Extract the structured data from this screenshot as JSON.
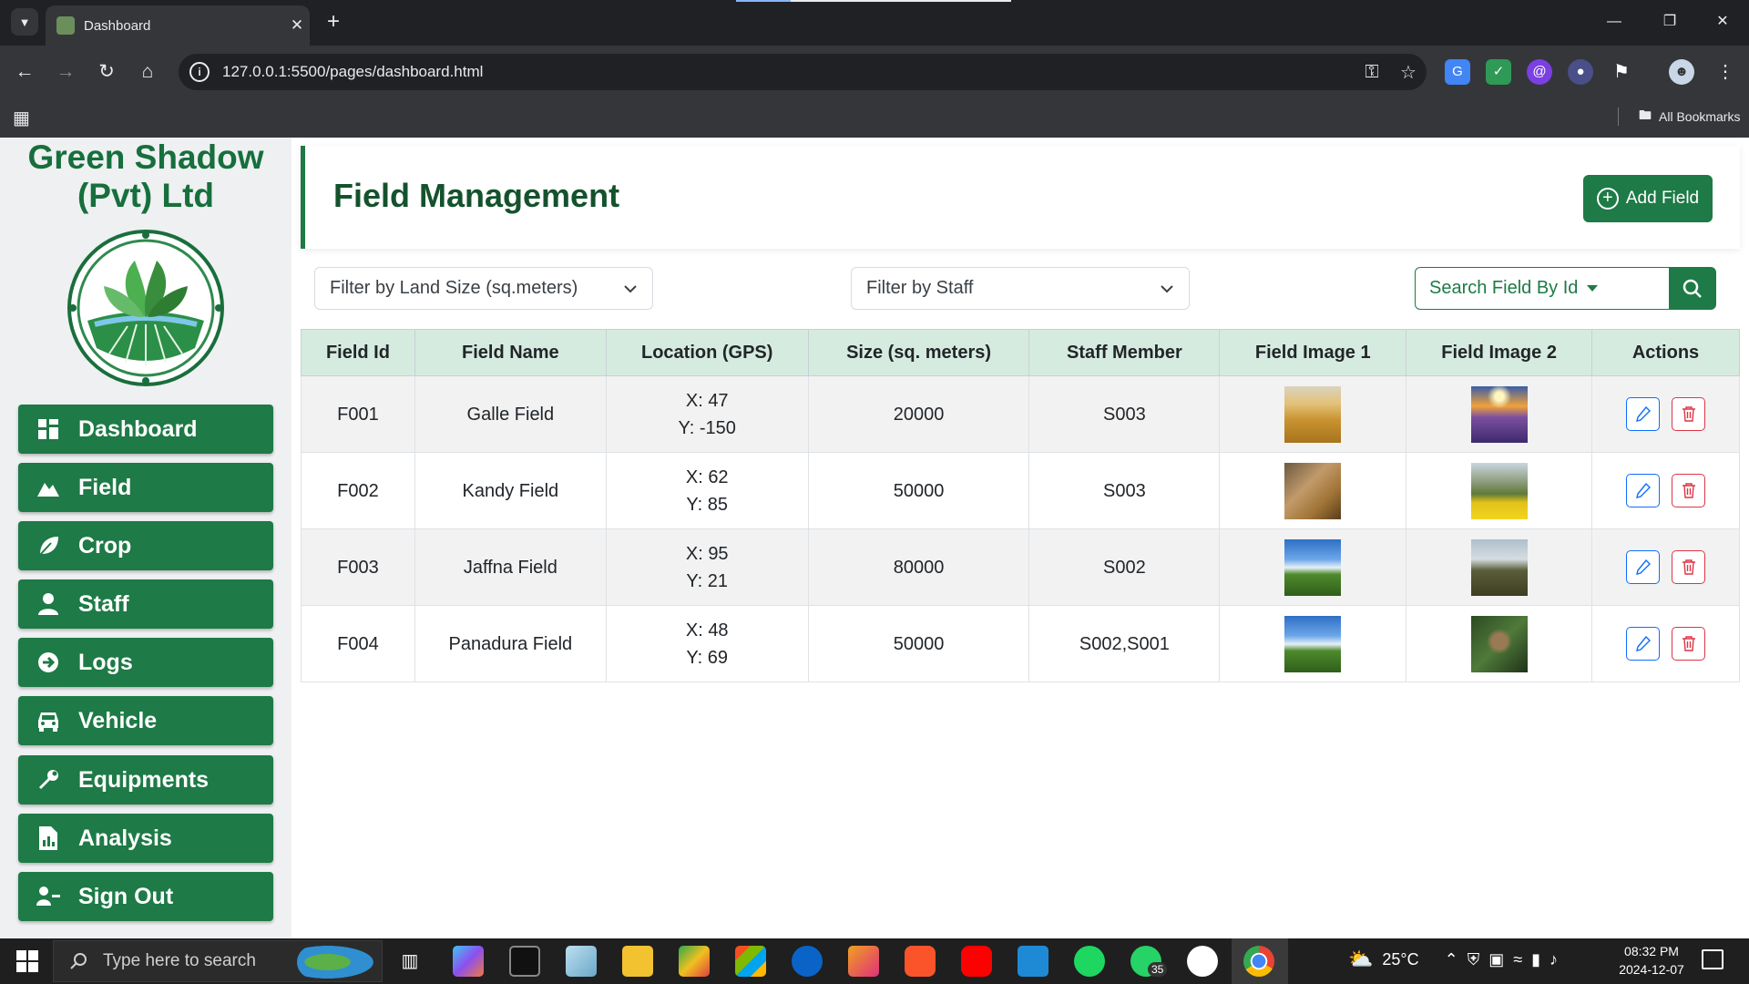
{
  "browser": {
    "tab_title": "Dashboard",
    "url": "127.0.0.1:5500/pages/dashboard.html",
    "all_bookmarks": "All Bookmarks"
  },
  "sidebar": {
    "brand_line1": "Green Shadow",
    "brand_line2": "(Pvt) Ltd",
    "items": [
      {
        "label": "Dashboard",
        "icon": "grid-icon"
      },
      {
        "label": "Field",
        "icon": "mountain-icon"
      },
      {
        "label": "Crop",
        "icon": "leaf-icon"
      },
      {
        "label": "Staff",
        "icon": "user-icon"
      },
      {
        "label": "Logs",
        "icon": "arrow-circle-icon"
      },
      {
        "label": "Vehicle",
        "icon": "car-icon"
      },
      {
        "label": "Equipments",
        "icon": "wrench-icon"
      },
      {
        "label": "Analysis",
        "icon": "chart-file-icon"
      },
      {
        "label": "Sign Out",
        "icon": "user-minus-icon"
      }
    ]
  },
  "main": {
    "title": "Field Management",
    "add_button": "Add Field",
    "filter_land_size": "Filter by Land Size (sq.meters)",
    "filter_staff": "Filter by Staff",
    "search_label": "Search Field By Id"
  },
  "table": {
    "headers": [
      "Field Id",
      "Field Name",
      "Location (GPS)",
      "Size (sq. meters)",
      "Staff Member",
      "Field Image 1",
      "Field Image 2",
      "Actions"
    ],
    "rows": [
      {
        "id": "F001",
        "name": "Galle Field",
        "loc_x": "X: 47",
        "loc_y": "Y: -150",
        "size": "20000",
        "staff": "S003"
      },
      {
        "id": "F002",
        "name": "Kandy Field",
        "loc_x": "X: 62",
        "loc_y": "Y: 85",
        "size": "50000",
        "staff": "S003"
      },
      {
        "id": "F003",
        "name": "Jaffna Field",
        "loc_x": "X: 95",
        "loc_y": "Y: 21",
        "size": "80000",
        "staff": "S002"
      },
      {
        "id": "F004",
        "name": "Panadura Field",
        "loc_x": "X: 48",
        "loc_y": "Y: 69",
        "size": "50000",
        "staff": "S002,S001"
      }
    ]
  },
  "taskbar": {
    "search_placeholder": "Type here to search",
    "weather": "25°C",
    "time": "08:32 PM",
    "date": "2024-12-07",
    "whatsapp_badge": "35"
  },
  "colors": {
    "primary": "#1e7a46",
    "header_bg": "#d6ebe0",
    "edit": "#0d6efd",
    "delete": "#dc3545"
  }
}
